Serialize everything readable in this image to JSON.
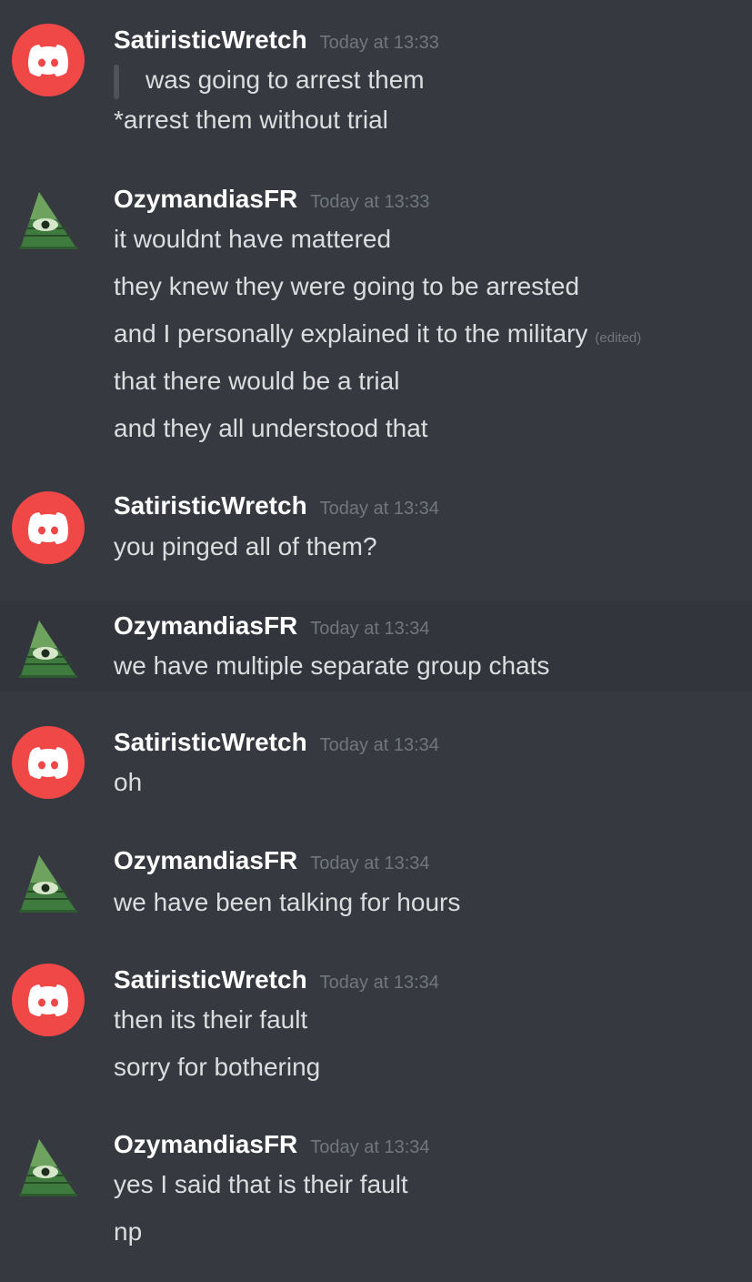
{
  "colors": {
    "background": "#36393f",
    "highlight_row": "#32353b",
    "username": "#ffffff",
    "message_text": "#dcddde",
    "timestamp": "#72767d",
    "discord_avatar": "#f04747",
    "quote_bar": "#4f545c"
  },
  "messages": [
    {
      "author": "SatiristicWretch",
      "avatar_icon": "discord-logo-icon",
      "timestamp": "Today at 13:33",
      "quote": "was going to arrest them",
      "lines": [
        "*arrest them without trial"
      ]
    },
    {
      "author": "OzymandiasFR",
      "avatar_icon": "illuminati-pyramid-icon",
      "timestamp": "Today at 13:33",
      "lines": [
        "it wouldnt have mattered",
        "they knew they were going to be arrested",
        "and I personally explained it to the military",
        "that there would be a trial",
        "and they all understood that"
      ],
      "edited_label": "(edited)"
    },
    {
      "author": "SatiristicWretch",
      "avatar_icon": "discord-logo-icon",
      "timestamp": "Today at 13:34",
      "lines": [
        "you pinged all of them?"
      ]
    },
    {
      "author": "OzymandiasFR",
      "avatar_icon": "illuminati-pyramid-icon",
      "timestamp": "Today at 13:34",
      "lines": [
        "we have multiple separate group chats"
      ]
    },
    {
      "author": "SatiristicWretch",
      "avatar_icon": "discord-logo-icon",
      "timestamp": "Today at 13:34",
      "lines": [
        "oh"
      ]
    },
    {
      "author": "OzymandiasFR",
      "avatar_icon": "illuminati-pyramid-icon",
      "timestamp": "Today at 13:34",
      "lines": [
        "we have been talking for hours"
      ]
    },
    {
      "author": "SatiristicWretch",
      "avatar_icon": "discord-logo-icon",
      "timestamp": "Today at 13:34",
      "lines": [
        "then its their fault",
        "sorry for bothering"
      ]
    },
    {
      "author": "OzymandiasFR",
      "avatar_icon": "illuminati-pyramid-icon",
      "timestamp": "Today at 13:34",
      "lines": [
        "yes I said that is their fault",
        "np"
      ]
    }
  ]
}
